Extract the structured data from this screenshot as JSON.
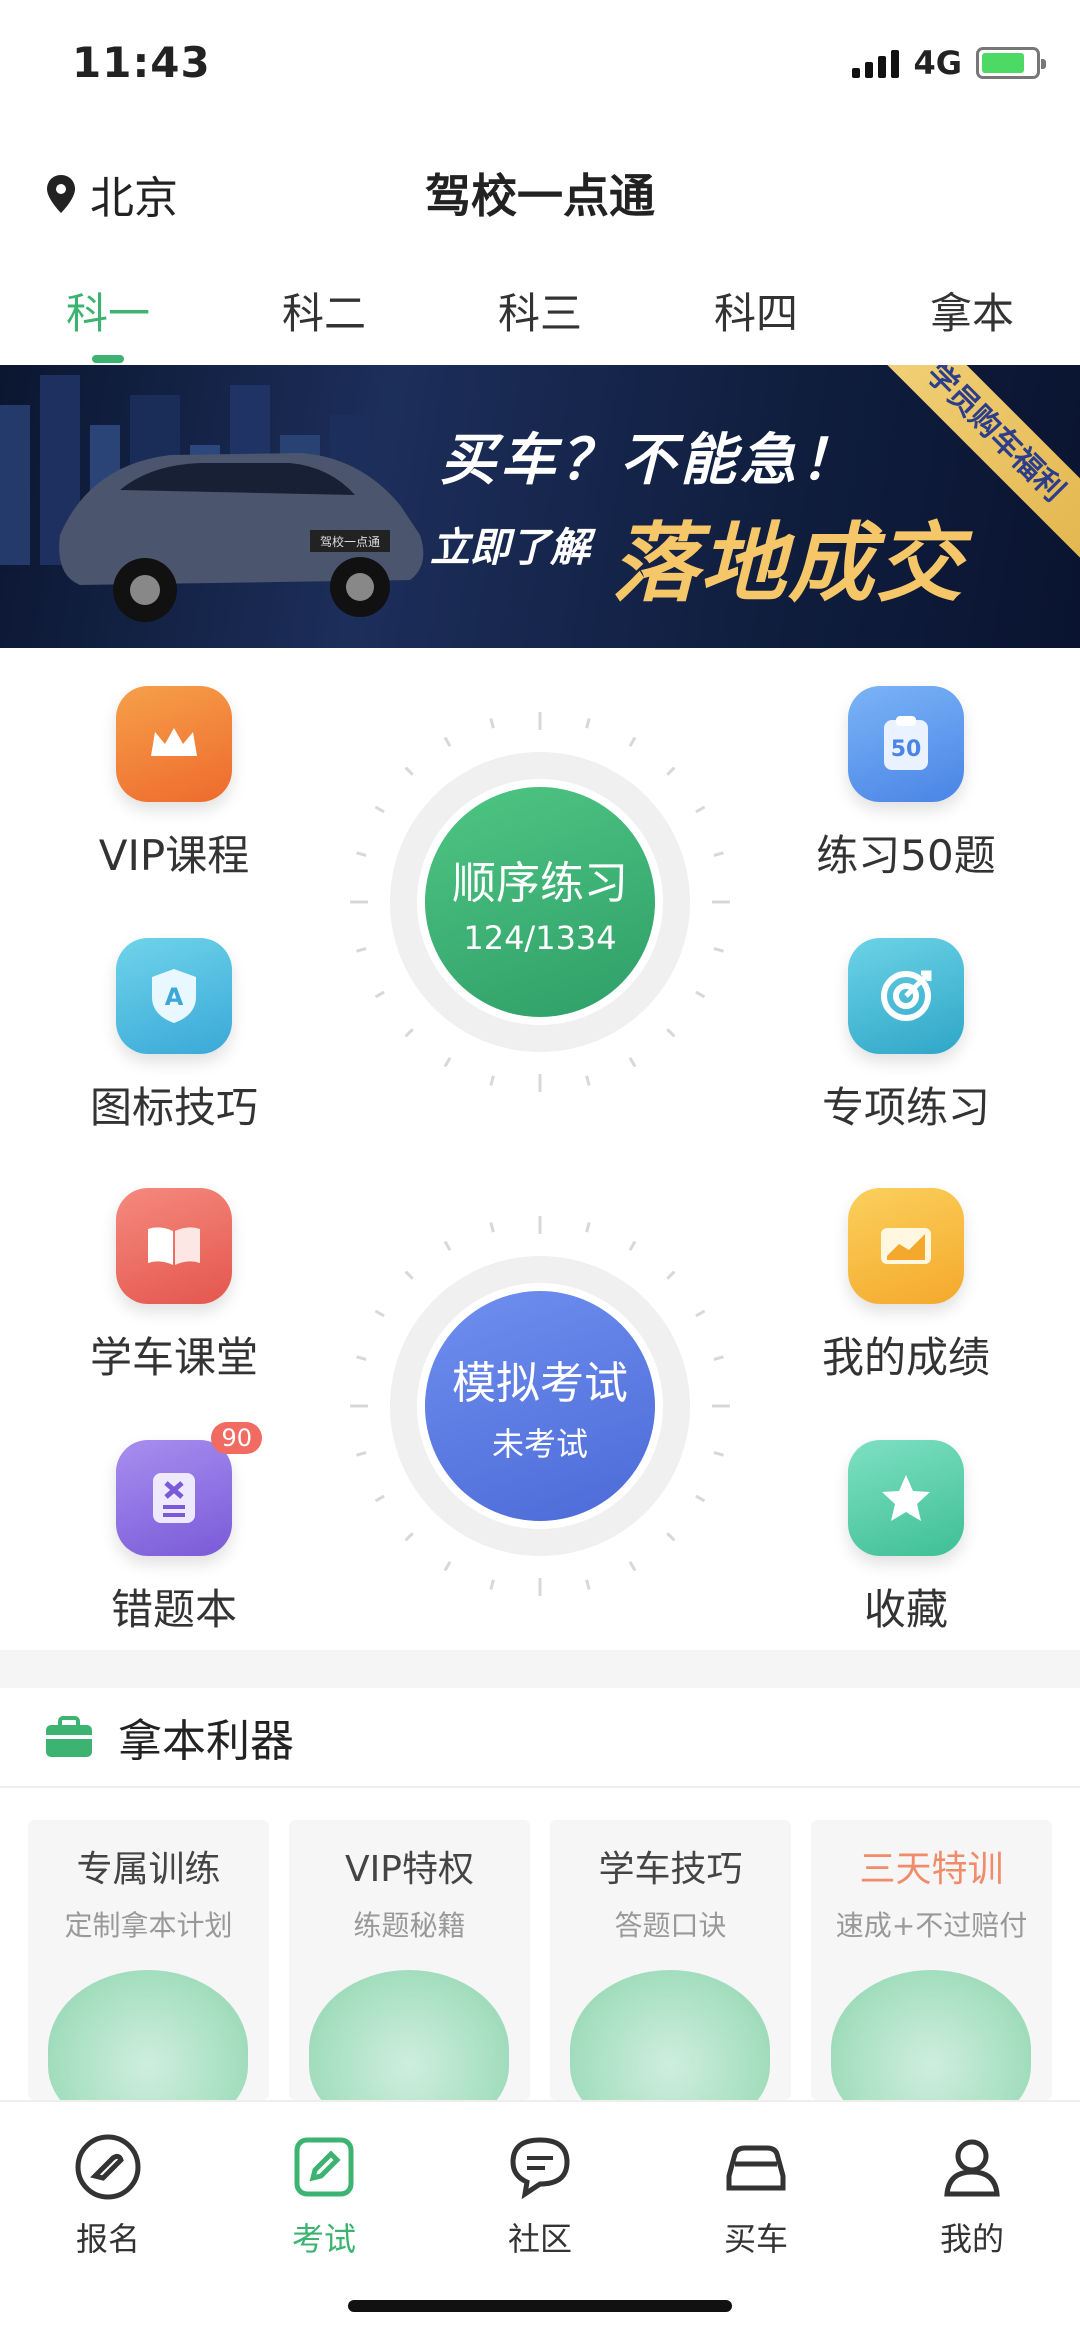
{
  "status": {
    "time": "11:43",
    "network": "4G",
    "battery_level": 0.8
  },
  "header": {
    "location": "北京",
    "title": "驾校一点通"
  },
  "tabs": [
    {
      "label": "科一",
      "active": true
    },
    {
      "label": "科二",
      "active": false
    },
    {
      "label": "科三",
      "active": false
    },
    {
      "label": "科四",
      "active": false
    },
    {
      "label": "拿本",
      "active": false
    }
  ],
  "banner": {
    "line1": "买车？不能急！",
    "line2": "立即了解",
    "line3": "落地成交",
    "corner": "学员购车福利",
    "car_plate": "驾校一点通"
  },
  "features": {
    "vip": "VIP课程",
    "practice50": "练习50题",
    "practice50_icon_text": "50",
    "signs": "图标技巧",
    "signs_icon_text": "A",
    "special": "专项练习",
    "classroom": "学车课堂",
    "scores": "我的成绩",
    "mistakes": "错题本",
    "mistakes_badge": "90",
    "favorites": "收藏"
  },
  "sequential": {
    "title": "顺序练习",
    "progress": "124/1334"
  },
  "mock_exam": {
    "title": "模拟考试",
    "status": "未考试"
  },
  "tools": {
    "title": "拿本利器",
    "cards": [
      {
        "title": "专属训练",
        "sub": "定制拿本计划"
      },
      {
        "title": "VIP特权",
        "sub": "练题秘籍"
      },
      {
        "title": "学车技巧",
        "sub": "答题口诀"
      },
      {
        "title": "三天特训",
        "sub": "速成+不过赔付"
      }
    ]
  },
  "nav": [
    {
      "label": "报名",
      "icon": "signup-icon"
    },
    {
      "label": "考试",
      "icon": "exam-icon",
      "active": true
    },
    {
      "label": "社区",
      "icon": "community-icon"
    },
    {
      "label": "买车",
      "icon": "car-icon"
    },
    {
      "label": "我的",
      "icon": "profile-icon"
    }
  ],
  "colors": {
    "accent": "#3cb371",
    "mock_blue": "#5b7be0",
    "badge_red": "#f26b63"
  }
}
